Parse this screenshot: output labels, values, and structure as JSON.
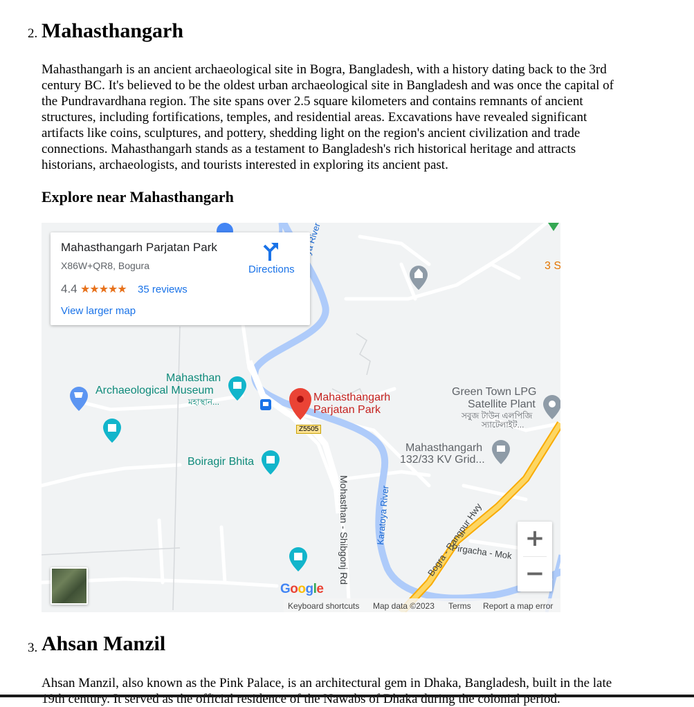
{
  "section2": {
    "number": "2.",
    "title": "Mahasthangarh",
    "description": "Mahasthangarh is an ancient archaeological site in Bogra, Bangladesh, with a history dating back to the 3rd century BC. It's believed to be the oldest urban archaeological site in Bangladesh and was once the capital of the Pundravardhana region. The site spans over 2.5 square kilometers and contains remnants of ancient structures, including fortifications, temples, and residential areas. Excavations have revealed significant artifacts like coins, sculptures, and pottery, shedding light on the region's ancient civilization and trade connections. Mahasthangarh stands as a testament to Bangladesh's rich historical heritage and attracts historians, archaeologists, and tourists interested in exploring its ancient past.",
    "explore_heading": "Explore near Mahasthangarh"
  },
  "map": {
    "card": {
      "place_name": "Mahasthangarh Parjatan Park",
      "address": "X86W+QR8, Bogura",
      "rating": "4.4",
      "stars": "★★★★★",
      "reviews": "35 reviews",
      "view_larger": "View larger map",
      "directions": "Directions"
    },
    "labels": {
      "museum_line1": "Mahasthan",
      "museum_line2": "Archaeological Museum",
      "museum_bn": "মহাস্থান...",
      "park_line1": "Mahasthangarh",
      "park_line2": "Parjatan Park",
      "road_badge": "Z5505",
      "boiragir": "Boiragir Bhita",
      "green_town_1": "Green Town LPG",
      "green_town_2": "Satellite Plant",
      "green_town_bn1": "সবুজ টাউন এলপিজি",
      "green_town_bn2": "স্যাটেলাইট...",
      "grid_1": "Mahasthangarh",
      "grid_2": "132/33 KV Grid...",
      "river_top": "Karatoya River",
      "river_bottom": "Karatoya River",
      "road_mohasthan": "Mohasthan - Shibgonj Rd",
      "hwy": "Bogra - Rangpur Hwy",
      "pirgacha": "Pirgacha - Mok",
      "edge_3s": "3 S",
      "edge_rd": "Rd"
    },
    "zoom_in": "+",
    "zoom_out": "−",
    "google_logo": "Google",
    "footer": {
      "shortcuts": "Keyboard shortcuts",
      "map_data": "Map data ©2023",
      "terms": "Terms",
      "report": "Report a map error"
    },
    "colors": {
      "water": "#aecbfa",
      "road": "#ffffff",
      "highway": "#fdd663",
      "pin": "#ea4335",
      "teal": "#12b5cb",
      "link": "#1a73e8"
    }
  },
  "section3": {
    "number": "3.",
    "title": "Ahsan Manzil",
    "description": "Ahsan Manzil, also known as the Pink Palace, is an architectural gem in Dhaka, Bangladesh, built in the late 19th century. It served as the official residence of the Nawabs of Dhaka during the colonial period."
  }
}
